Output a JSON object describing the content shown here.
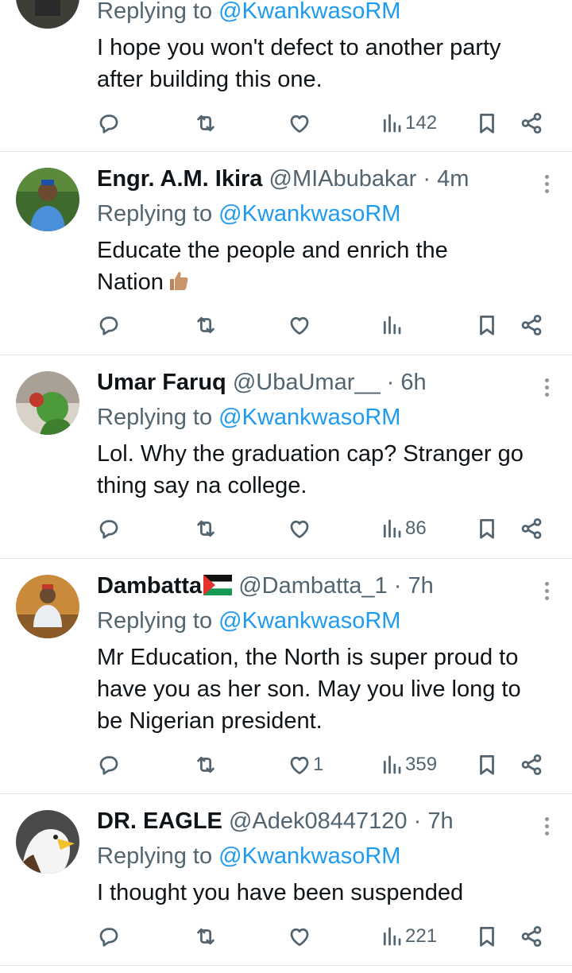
{
  "replying_prefix": "Replying to",
  "replying_handle": "@KwankwasoRM",
  "tweets": [
    {
      "name": "",
      "handle": "",
      "time": "",
      "text_lines": [
        "I hope you won't defect to another party",
        "after building this one."
      ],
      "views": "142",
      "likes": ""
    },
    {
      "name": "Engr. A.M. Ikira",
      "handle": "@MIAbubakar",
      "time": "4m",
      "text_lines": [
        "Educate the people and enrich the",
        "Nation"
      ],
      "views": "",
      "likes": ""
    },
    {
      "name": "Umar Faruq",
      "handle": "@UbaUmar__",
      "time": "6h",
      "text_lines": [
        "Lol. Why the graduation cap? Stranger go",
        "thing say na college."
      ],
      "views": "86",
      "likes": ""
    },
    {
      "name": "Dambatta",
      "handle": "@Dambatta_1",
      "time": "7h",
      "text_lines": [
        "Mr Education, the North is super proud to",
        "have you as her son. May you live long to",
        "be Nigerian president."
      ],
      "views": "359",
      "likes": "1"
    },
    {
      "name": "DR. EAGLE",
      "handle": "@Adek08447120",
      "time": "7h",
      "text_lines": [
        "I thought you have been suspended"
      ],
      "views": "221",
      "likes": ""
    }
  ],
  "separator": "·",
  "icons": {
    "reply": "reply-icon",
    "retweet": "retweet-icon",
    "like": "heart-icon",
    "views": "views-icon",
    "bookmark": "bookmark-icon",
    "share": "share-icon",
    "more": "more-icon",
    "thumbs_up": "thumbs-up-emoji",
    "flag": "palestine-flag-emoji"
  },
  "colors": {
    "link": "#1d9bf0",
    "muted": "#536471",
    "text": "#0f1419"
  }
}
